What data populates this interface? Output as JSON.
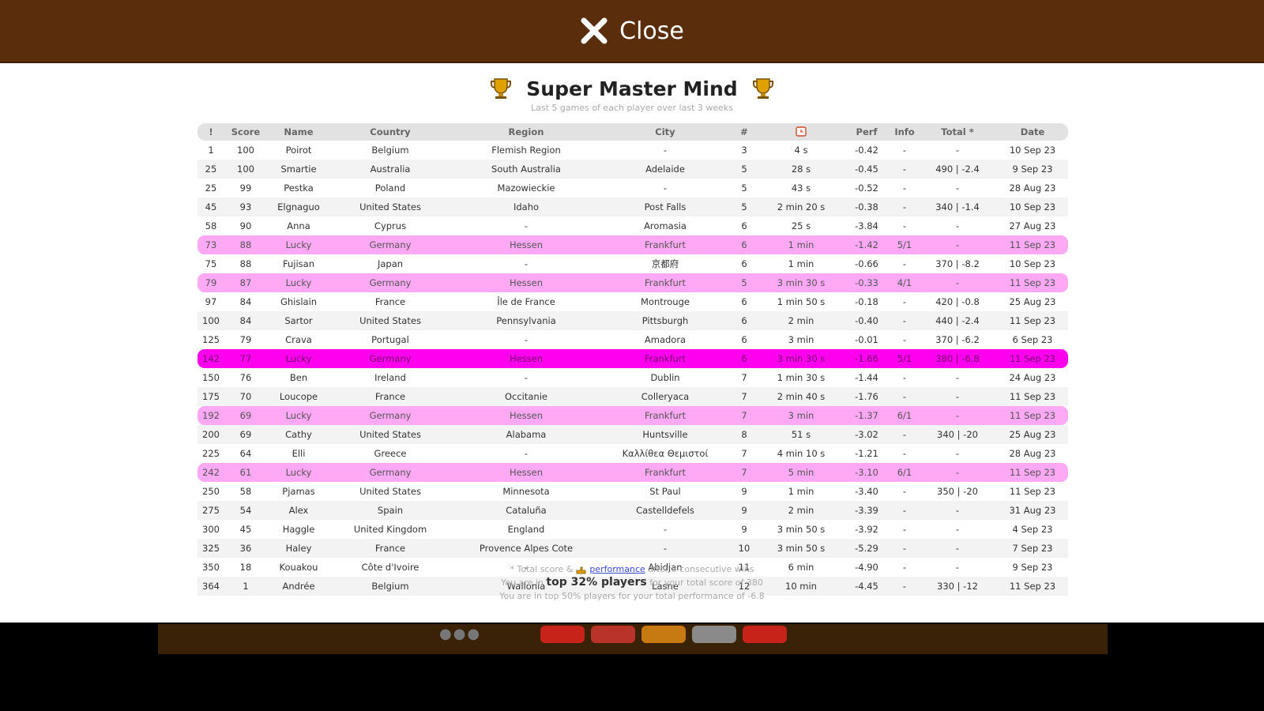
{
  "header": {
    "close_label": "Close"
  },
  "panel": {
    "title": "Super Master Mind",
    "subtitle": "Last 5 games of each player over last 3 weeks",
    "columns": [
      "!",
      "Score",
      "Name",
      "Country",
      "Region",
      "City",
      "#",
      "",
      "Perf",
      "Info",
      "Total *",
      "Date"
    ],
    "rows": [
      [
        "1",
        "100",
        "Poirot",
        "Belgium",
        "Flemish Region",
        "-",
        "3",
        "4 s",
        "-0.42",
        "-",
        "-",
        "10 Sep 23"
      ],
      [
        "25",
        "100",
        "Smartie",
        "Australia",
        "South Australia",
        "Adelaide",
        "5",
        "28 s",
        "-0.45",
        "-",
        "490 | -2.4",
        "9 Sep 23"
      ],
      [
        "25",
        "99",
        "Pestka",
        "Poland",
        "Mazowieckie",
        "-",
        "5",
        "43 s",
        "-0.52",
        "-",
        "-",
        "28 Aug 23"
      ],
      [
        "45",
        "93",
        "Elgnaguo",
        "United States",
        "Idaho",
        "Post Falls",
        "5",
        "2 min 20 s",
        "-0.38",
        "-",
        "340 | -1.4",
        "10 Sep 23"
      ],
      [
        "58",
        "90",
        "Anna",
        "Cyprus",
        "-",
        "Aromasia",
        "6",
        "25 s",
        "-3.84",
        "-",
        "-",
        "27 Aug 23"
      ],
      [
        "73",
        "88",
        "Lucky",
        "Germany",
        "Hessen",
        "Frankfurt",
        "6",
        "1 min",
        "-1.42",
        "5/1",
        "-",
        "11 Sep 23"
      ],
      [
        "75",
        "88",
        "Fujisan",
        "Japan",
        "-",
        "京都府",
        "6",
        "1 min",
        "-0.66",
        "-",
        "370 | -8.2",
        "10 Sep 23"
      ],
      [
        "79",
        "87",
        "Lucky",
        "Germany",
        "Hessen",
        "Frankfurt",
        "5",
        "3 min 30 s",
        "-0.33",
        "4/1",
        "-",
        "11 Sep 23"
      ],
      [
        "97",
        "84",
        "Ghislain",
        "France",
        "Île de France",
        "Montrouge",
        "6",
        "1 min 50 s",
        "-0.18",
        "-",
        "420 | -0.8",
        "25 Aug 23"
      ],
      [
        "100",
        "84",
        "Sartor",
        "United States",
        "Pennsylvania",
        "Pittsburgh",
        "6",
        "2 min",
        "-0.40",
        "-",
        "440 | -2.4",
        "11 Sep 23"
      ],
      [
        "125",
        "79",
        "Crava",
        "Portugal",
        "-",
        "Amadora",
        "6",
        "3 min",
        "-0.01",
        "-",
        "370 | -6.2",
        "6 Sep 23"
      ],
      [
        "142",
        "77",
        "Lucky",
        "Germany",
        "Hessen",
        "Frankfurt",
        "6",
        "3 min 30 s",
        "-1.66",
        "5/1",
        "380 | -6.8",
        "11 Sep 23"
      ],
      [
        "150",
        "76",
        "Ben",
        "Ireland",
        "-",
        "Dublin",
        "7",
        "1 min 30 s",
        "-1.44",
        "-",
        "-",
        "24 Aug 23"
      ],
      [
        "175",
        "70",
        "Loucope",
        "France",
        "Occitanie",
        "Colleryaca",
        "7",
        "2 min 40 s",
        "-1.76",
        "-",
        "-",
        "11 Sep 23"
      ],
      [
        "192",
        "69",
        "Lucky",
        "Germany",
        "Hessen",
        "Frankfurt",
        "7",
        "3 min",
        "-1.37",
        "6/1",
        "-",
        "11 Sep 23"
      ],
      [
        "200",
        "69",
        "Cathy",
        "United States",
        "Alabama",
        "Huntsville",
        "8",
        "51 s",
        "-3.02",
        "-",
        "340 | -20",
        "25 Aug 23"
      ],
      [
        "225",
        "64",
        "Elli",
        "Greece",
        "-",
        "Καλλίθεα Θεμιστοί",
        "7",
        "4 min 10 s",
        "-1.21",
        "-",
        "-",
        "28 Aug 23"
      ],
      [
        "242",
        "61",
        "Lucky",
        "Germany",
        "Hessen",
        "Frankfurt",
        "7",
        "5 min",
        "-3.10",
        "6/1",
        "-",
        "11 Sep 23"
      ],
      [
        "250",
        "58",
        "Pjamas",
        "United States",
        "Minnesota",
        "St Paul",
        "9",
        "1 min",
        "-3.40",
        "-",
        "350 | -20",
        "11 Sep 23"
      ],
      [
        "275",
        "54",
        "Alex",
        "Spain",
        "Cataluña",
        "Castelldefels",
        "9",
        "2 min",
        "-3.39",
        "-",
        "-",
        "31 Aug 23"
      ],
      [
        "300",
        "45",
        "Haggle",
        "United Kingdom",
        "England",
        "-",
        "9",
        "3 min 50 s",
        "-3.92",
        "-",
        "-",
        "4 Sep 23"
      ],
      [
        "325",
        "36",
        "Haley",
        "France",
        "Provence Alpes Cote",
        "-",
        "10",
        "3 min 50 s",
        "-5.29",
        "-",
        "-",
        "7 Sep 23"
      ],
      [
        "350",
        "18",
        "Kouakou",
        "Côte d'Ivoire",
        "-",
        "Abidjan",
        "11",
        "6 min",
        "-4.90",
        "-",
        "-",
        "9 Sep 23"
      ],
      [
        "364",
        "1",
        "Andrée",
        "Belgium",
        "Wallonia",
        "Lasne",
        "12",
        "10 min",
        "-4.45",
        "-",
        "330 | -12",
        "11 Sep 23"
      ]
    ],
    "row_types": [
      "odd",
      "even",
      "odd",
      "even",
      "odd",
      "me",
      "odd",
      "me",
      "odd",
      "even",
      "odd",
      "current",
      "odd",
      "even",
      "me",
      "even",
      "odd",
      "me",
      "odd",
      "even",
      "odd",
      "even",
      "odd",
      "even"
    ],
    "footer": {
      "line1_prefix": "* Total score & ",
      "line1_link": "performance",
      "line1_suffix": " after 5 consecutive wins",
      "line2_prefix": "You are in ",
      "line2_strong": "top 32% players",
      "line2_suffix": " for your total score of 380",
      "line3": "You are in top 50% players for your total performance of -6.8"
    }
  },
  "colors": {
    "header_bg": "#5a2e0c",
    "me_row": "#ffa9f5",
    "current_row": "#ff00ee",
    "trophy": "#e0a000"
  },
  "icons": {
    "close": "close-x-icon",
    "trophy": "trophy-icon",
    "clock": "clock-icon",
    "hand": "hand-pointer-icon"
  }
}
